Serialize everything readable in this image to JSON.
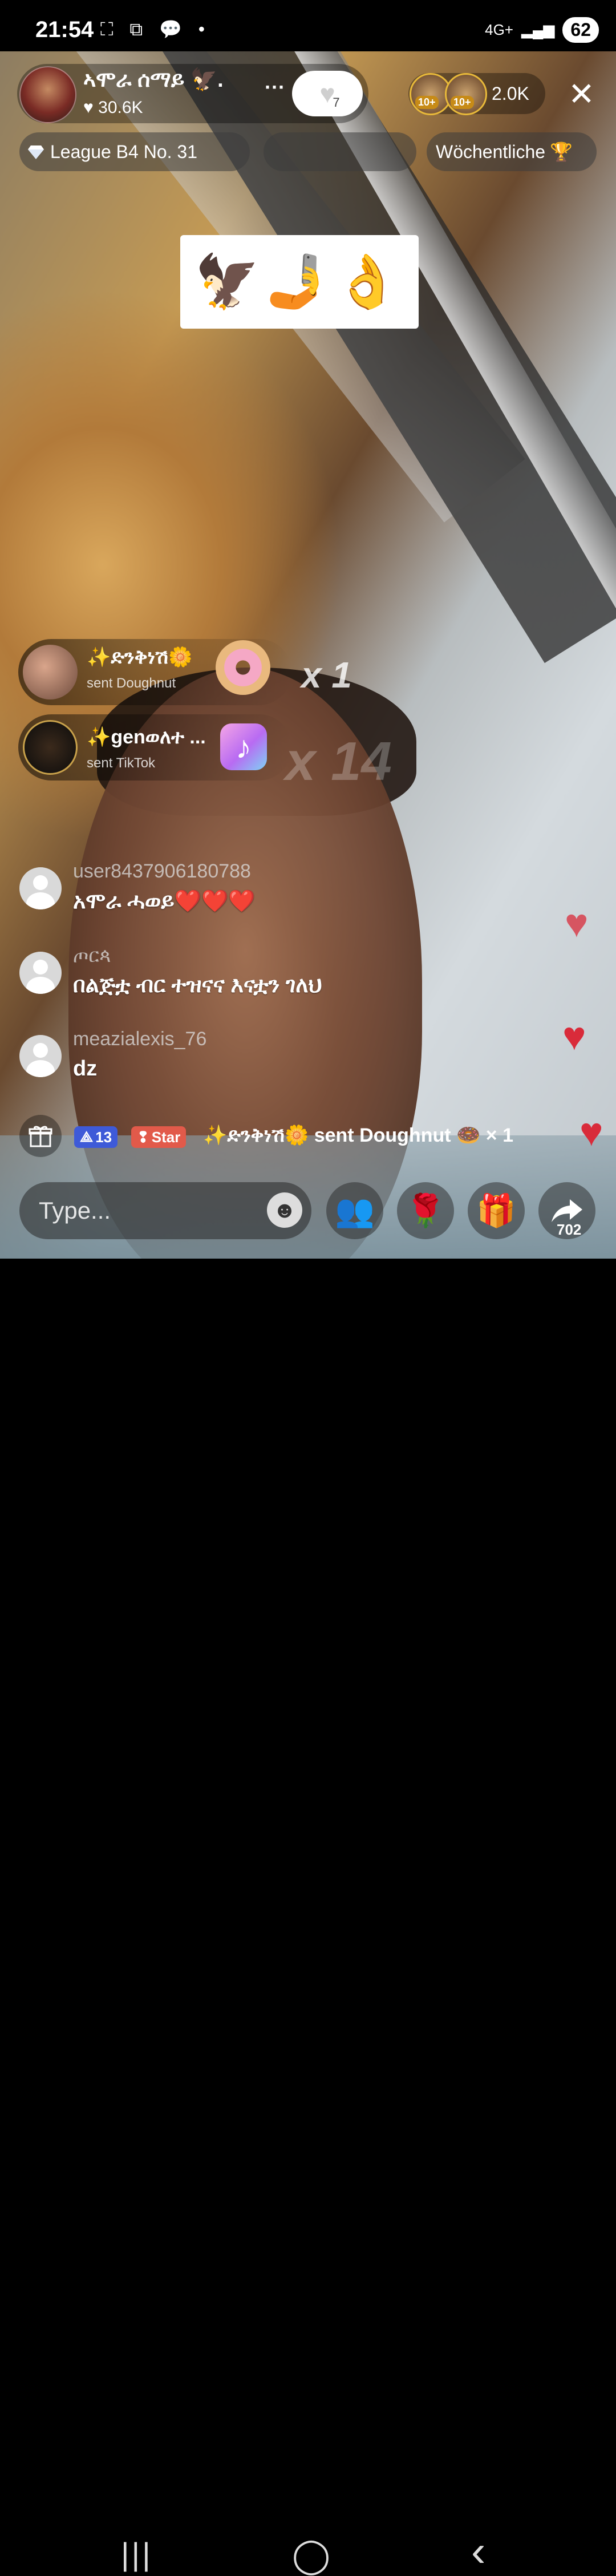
{
  "status_bar": {
    "time": "21:54",
    "left_icons": "⛶ ⧉ 💬 •",
    "network": "4G+",
    "signal": "▂▄▆",
    "battery": "62"
  },
  "host": {
    "name": "ኣሞራ ሰማይ 🦅.",
    "likes": "30.6K",
    "more": "···",
    "follow_heart_count": "7"
  },
  "viewers": {
    "badge_1": "10+",
    "badge_2": "10+",
    "count": "2.0K"
  },
  "close_label": "✕",
  "tags": {
    "league": "League B4 No. 31",
    "weekly": "Wöchentliche",
    "weekly_icon": "🏆"
  },
  "pinned_emojis": "🦅🤳👌",
  "gift_combos": [
    {
      "user": "✨ድንቅነሽ🌼",
      "sent": "sent Doughnut",
      "count": "x 1"
    },
    {
      "user": "✨genወለተ ...",
      "sent": "sent TikTok",
      "count": "x 14",
      "icon_letter": "♪"
    }
  ],
  "chat": [
    {
      "user": "user8437906180788",
      "message": "አሞራ ሓወይ❤️❤️❤️"
    },
    {
      "user": "ጦርጳ",
      "message": "በልጅቷ ብር ተዝናና እናቷን ገለህ"
    },
    {
      "user": "meazialexis_76",
      "message": "dz"
    }
  ],
  "gift_notification": {
    "level": "13",
    "star": "Star",
    "text": "✨ድንቅነሽ🌼 sent Doughnut 🍩 × 1"
  },
  "bottom_bar": {
    "placeholder": "Type...",
    "emoji_icon": "☻",
    "people_icon": "👥",
    "rose_icon": "🌹",
    "gift_icon": "🎁",
    "share_count": "702"
  },
  "nav": {
    "recents": "|||",
    "home": "◯",
    "back": "‹"
  },
  "colors": {
    "heart_red": "#d92b3a",
    "level_badge": "#3e5ad8",
    "star_badge": "#e25a4a"
  }
}
